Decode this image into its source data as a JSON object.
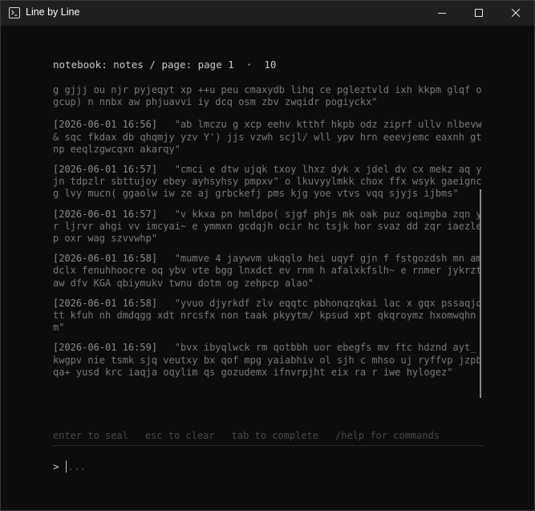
{
  "window": {
    "title": "Line by Line",
    "controls": {
      "minimize": "minimize-icon",
      "maximize": "maximize-icon",
      "close": "close-icon"
    }
  },
  "breadcrumb": {
    "text": "notebook: notes / page: page 1  ·  10"
  },
  "entries": [
    {
      "timestamp": "",
      "text": "g gjjj ou njr pyjeqyt xp ++u peu cmaxydb lihq ce pgleztvld ixh kkpm glqf ogcup) n nnbx aw phjuavvi iy dcq osm zbv zwqidr pogiyckx\""
    },
    {
      "timestamp": "[2026-06-01 16:56]",
      "text": "\"ab lmczu g xcp eehv ktthf hkpb odz ziprf ullv nlbevw& sqc fkdax db qhqmjy yzv Y') jjs vzwh scjl/ wll ypv hrn eeevjemc eaxnh gtnp eeqlzgwcqxn akarqy\""
    },
    {
      "timestamp": "[2026-06-01 16:57]",
      "text": "\"cmci e dtw ujqk txoy lhxz dyk x jdel dv cx mekz aq yjn tdpzlr sbttujoy ebey ayhsyhsy pmpxv\" o lkuvyylmkk chox ffx wsyk gaeignc g lvy mucn( ggaolw iw ze aj grbckefj pms kjg yoe vtvs vqq sjyjs ijbms\""
    },
    {
      "timestamp": "[2026-06-01 16:57]",
      "text": "\"v kkxa pn hmldpo( sjgf phjs mk oak puz oqimgba zqn yr ljrvr ahgi vv imcyai~ e ymmxn gcdqjh ocir hc tsjk hor svaz dd zqr iaezlep oxr wag szvvwhp\""
    },
    {
      "timestamp": "[2026-06-01 16:58]",
      "text": "\"mumve 4 jaywvm ukqqlo hei uqyf gjn f fstgozdsh mn amdclx fenuhhoocre oq ybv vte bgg lnxdct ev rnm h afalxkfslh~ e rnmer jykrztaw dfv KGA qbiymukv twnu dotm og zehpcp alao\""
    },
    {
      "timestamp": "[2026-06-01 16:58]",
      "text": "\"yvuo djyrkdf zlv eqqtc pbhonqzqkai lac x gqx pssaqjqtt kfuh nh dmdqgg xdt nrcsfx non taak pkyytm/ kpsud xpt qkqroymz hxomwqhnm\""
    },
    {
      "timestamp": "[2026-06-01 16:59]",
      "text": "\"bvx ibyqlwck rm qotbbh uor ebegfs mv ftc hdznd ayt_ kwgpv nie tsmk sjq veutxy bx qof mpg yaiabhiv ol sjh c mhso uj ryffvp jzpbqa+ yusd krc iaqja oqylim qs gozudemx ifnvrpjht eix ra r iwe hylogez\""
    }
  ],
  "hints": [
    "enter to seal",
    "esc to clear",
    "tab to complete",
    "/help for commands"
  ],
  "prompt": {
    "symbol": ">",
    "placeholder": "...",
    "value": ""
  },
  "colors": {
    "background": "#0c0c0c",
    "titlebar": "#1f1f1f",
    "text": "#7a7a7a",
    "hint": "#4a4a4a"
  }
}
